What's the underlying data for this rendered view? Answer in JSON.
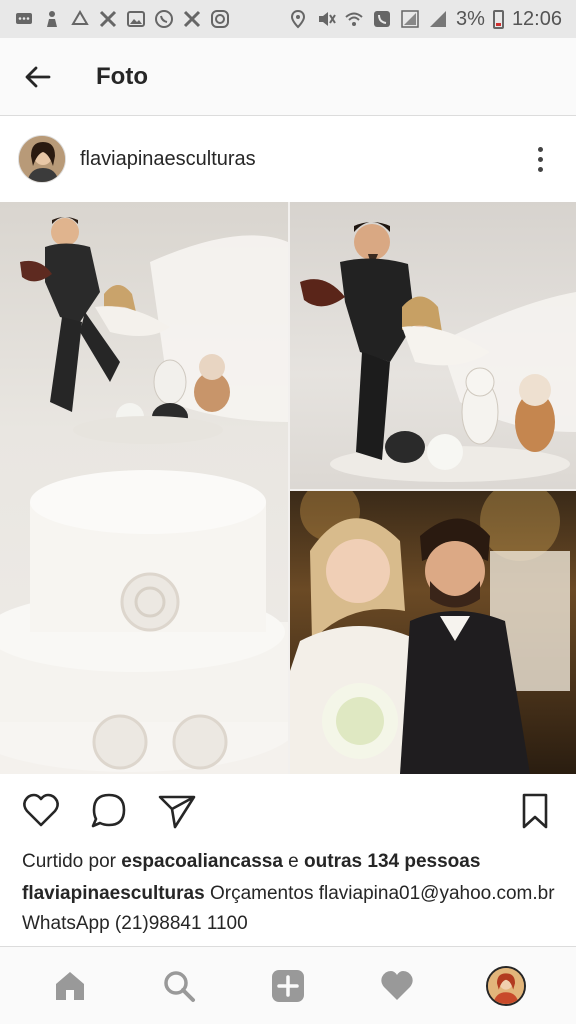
{
  "status_bar": {
    "battery_percent": "3%",
    "time": "12:06"
  },
  "header": {
    "title": "Foto",
    "back_icon": "arrow-left-icon"
  },
  "post": {
    "username": "flaviapinaesculturas",
    "more_icon": "more-vertical-icon",
    "likes_prefix": "Curtido por ",
    "likes_user": "espacoaliancassa",
    "likes_middle": " e ",
    "likes_others": "outras 134 pessoas",
    "caption_user": "flaviapinaesculturas",
    "caption_text": " Orçamentos flaviapina01@yahoo.com.br WhatsApp (21)98841 1100"
  },
  "actions": {
    "like_icon": "heart-icon",
    "comment_icon": "comment-icon",
    "share_icon": "send-icon",
    "save_icon": "bookmark-icon"
  },
  "bottom_nav": {
    "items": [
      "home-icon",
      "search-icon",
      "add-icon",
      "activity-heart-icon",
      "profile-avatar"
    ]
  },
  "colors": {
    "status_bar_bg": "#e8e8e8",
    "header_bg": "#fafafa",
    "text": "#262626",
    "nav_icon_gray": "#999999"
  }
}
